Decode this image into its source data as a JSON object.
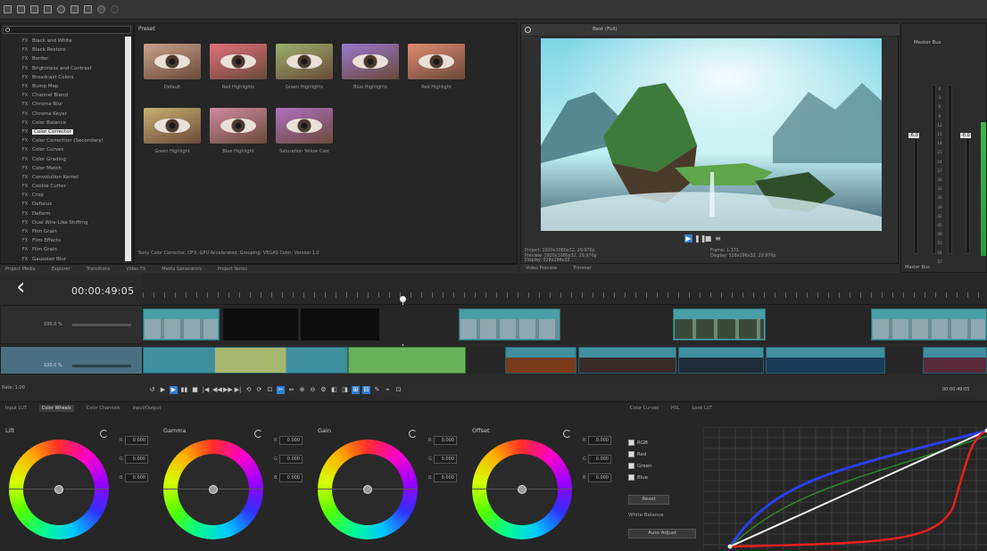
{
  "toolbar": {
    "icons": [
      "new-icon",
      "open-icon",
      "save-icon",
      "render-icon",
      "settings-icon",
      "cursor-icon",
      "trim-icon",
      "undo-icon",
      "redo-icon"
    ]
  },
  "effects": {
    "search_placeholder": "",
    "items": [
      "Black and White",
      "Black Restore",
      "Border",
      "Brightness and Contrast",
      "Broadcast Colors",
      "Bump Map",
      "Channel Blend",
      "Chroma Blur",
      "Chroma Keyer",
      "Color Balance",
      "Color Corrector",
      "Color Correction (Secondary)",
      "Color Curves",
      "Color Grading",
      "Color Match",
      "Convolution Kernel",
      "Cookie Cutter",
      "Crop",
      "Defocus",
      "Deform",
      "Dual Wire-Like Shifting",
      "Film Grain",
      "Flim Effects",
      "Film Grain",
      "Gaussian Blur"
    ],
    "selected_index": 10,
    "preset_header": "Preset",
    "presets": [
      "Default",
      "Red Highlights",
      "Green Highlights",
      "Blue Highlights",
      "Red Highlight",
      "Green Highlight",
      "Blue Highlight",
      "Saturation Yellow Cast"
    ],
    "status": "Sony Color Corrector, OFX, GPU Accelerated, Grouping: VEGAS Color, Version 1.0",
    "tabs": [
      "Project Media",
      "Explorer",
      "Transitions",
      "Video FX",
      "Media Generators",
      "Project Notes"
    ]
  },
  "preview": {
    "toolbar_label": "Best (Full)",
    "info_left": [
      "Project: 1920x1080x32, 29.970p",
      "Preview: 1920x1080x32, 29.970p",
      "Display: 528x296x32"
    ],
    "info_right": [
      "Frame: 1,371",
      "Display: 528x296x32, 29.970p"
    ],
    "tabs": [
      "Video Preview",
      "Trimmer"
    ]
  },
  "master": {
    "title": "Master Bus",
    "tabs": [
      "Master Bus"
    ],
    "scale": [
      "0",
      "3",
      "6",
      "9",
      "12",
      "15",
      "18",
      "21",
      "24",
      "27",
      "30",
      "33",
      "36",
      "39",
      "42",
      "45",
      "48",
      "51",
      "54",
      "57"
    ],
    "left_level": "-6.0",
    "right_level": "-6.0"
  },
  "timeline": {
    "timecode": "00:00:49:05",
    "track1": {
      "level": "100.0 %"
    },
    "track2": {
      "level": "100.0 %"
    },
    "rate": "Rate: 1.00",
    "end_time": "00:00:49:05"
  },
  "grading": {
    "tabs": [
      "Input LUT",
      "Color Wheels",
      "Color Channels",
      "Input/Output"
    ],
    "active_tab": 1,
    "wheels": [
      {
        "title": "Lift",
        "r": "0.000",
        "g": "0.000",
        "b": "0.000"
      },
      {
        "title": "Gamma",
        "r": "0.000",
        "g": "0.000",
        "b": "0.000"
      },
      {
        "title": "Gain",
        "r": "0.000",
        "g": "0.000",
        "b": "0.000"
      },
      {
        "title": "Offset",
        "r": "0.000",
        "g": "0.000",
        "b": "0.000"
      }
    ],
    "curve_tabs": [
      "Color Curves",
      "HSL",
      "Look LUT"
    ],
    "checks": [
      "RGB",
      "Red",
      "Green",
      "Blue"
    ],
    "reset_label": "Reset",
    "white_balance_label": "White Balance",
    "auto_adjust_label": "Auto Adjust"
  },
  "colors": {
    "accent": "#2e7fd3",
    "clip": "#4a9ea6"
  }
}
